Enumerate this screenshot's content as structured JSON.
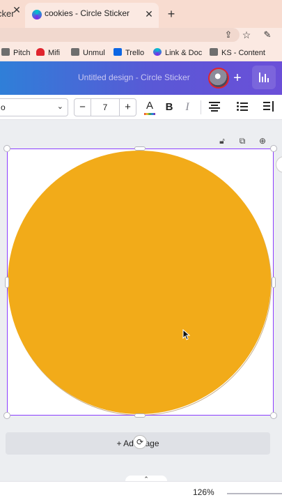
{
  "browser": {
    "tabs": [
      {
        "label": "cker",
        "active": false
      },
      {
        "label": "cookies - Circle Sticker",
        "active": true
      }
    ],
    "new_tab_icon": "plus-icon",
    "bookmarks": [
      {
        "label": "Pitch",
        "icon": "folder-icon"
      },
      {
        "label": "Mifi",
        "icon": "huawei-icon"
      },
      {
        "label": "Unmul",
        "icon": "folder-icon"
      },
      {
        "label": "Trello",
        "icon": "trello-icon"
      },
      {
        "label": "Link & Doc",
        "icon": "canva-icon"
      },
      {
        "label": "KS - Content",
        "icon": "folder-icon"
      }
    ]
  },
  "editor": {
    "design_title": "Untitled design - Circle Sticker",
    "font_name": "o",
    "font_size": "7",
    "add_page_label": "+ Add page",
    "zoom": "126%"
  },
  "colors": {
    "header_gradient_start": "#2f7fd8",
    "header_gradient_end": "#6b4fd8",
    "circle_fill": "#f2ab19",
    "selection": "#8b3dff",
    "tab_strip": "#f8dcd0"
  }
}
